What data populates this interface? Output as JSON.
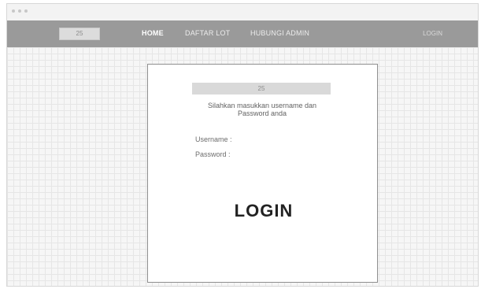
{
  "header": {
    "logo_label": "25",
    "nav": [
      {
        "label": "HOME",
        "active": true
      },
      {
        "label": "DAFTAR LOT",
        "active": false
      },
      {
        "label": "HUBUNGI ADMIN",
        "active": false
      }
    ],
    "login_label": "LOGIN"
  },
  "login_card": {
    "logo_label": "25",
    "instruction_line1": "Silahkan masukkan username dan",
    "instruction_line2": "Password anda",
    "username_label": "Username :",
    "password_label": "Password :",
    "submit_label": "LOGIN"
  },
  "colors": {
    "navbar": "#9a9a9a",
    "grid_background": "#f6f6f6",
    "card_border": "#8f8f8f"
  }
}
